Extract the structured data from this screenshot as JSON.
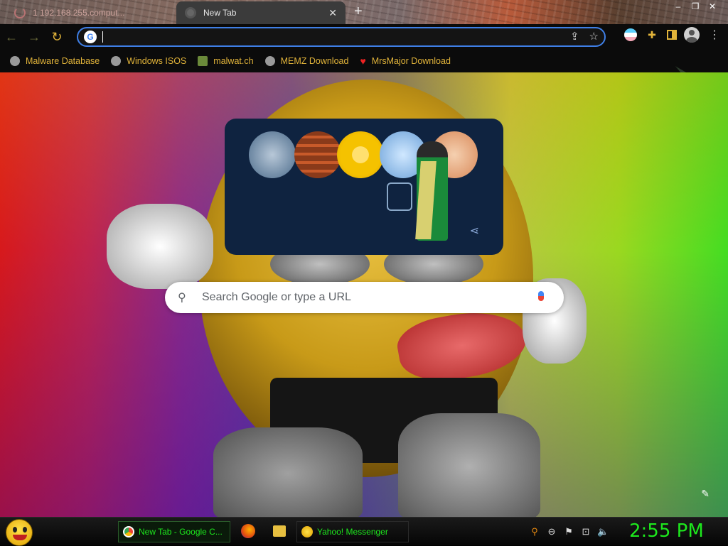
{
  "tabs": {
    "inactive_title": "1 192.168.255.comput...",
    "active_title": "New Tab",
    "new_tab_symbol": "+"
  },
  "window_controls": {
    "minimize": "–",
    "restore": "❐",
    "close": "✕"
  },
  "toolbar": {
    "back": "←",
    "forward": "→",
    "reload": "↻",
    "omnibox_value": "",
    "share": "⇪",
    "bookmark_star": "☆",
    "extensions": [
      "trans-flag-extension-icon",
      "puzzle-icon",
      "side-panel-icon",
      "profile-icon"
    ],
    "menu": "⋮"
  },
  "bookmarks": [
    {
      "label": "Malware Database",
      "icon": "globe-icon"
    },
    {
      "label": "Windows ISOS",
      "icon": "globe-icon"
    },
    {
      "label": "malwat.ch",
      "icon": "person-icon"
    },
    {
      "label": "MEMZ Download",
      "icon": "globe-icon"
    },
    {
      "label": "MrsMajor Download",
      "icon": "heart-icon"
    }
  ],
  "newtab": {
    "search_placeholder": "Search Google or type a URL",
    "search_icon": "search-icon",
    "mic_icon": "microphone-icon",
    "share_symbol": "⟨",
    "customize_symbol": "✎"
  },
  "taskbar": {
    "chrome_task": "New Tab - Google C...",
    "yahoo_task": "Yahoo! Messenger",
    "clock": "2:55 PM"
  },
  "tray": {
    "search": "⚲",
    "dash": "⊖",
    "flag": "⚑",
    "network": "⊡",
    "volume": "🔈"
  },
  "colors": {
    "accent_gold": "#e2b43a",
    "taskbar_green": "#1de81d",
    "omnibox_border": "#3f7fe6"
  }
}
